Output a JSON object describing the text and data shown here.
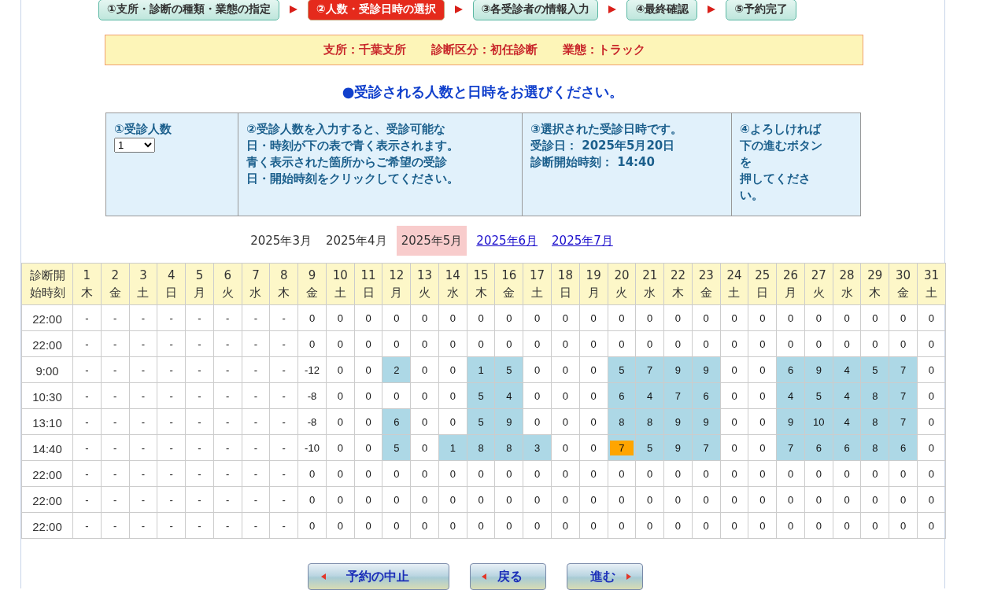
{
  "steps": [
    {
      "label": "①支所・診断の種類・業態の指定",
      "selected": false
    },
    {
      "label": "②人数・受診日時の選択",
      "selected": true
    },
    {
      "label": "③各受診者の情報入力",
      "selected": false
    },
    {
      "label": "④最終確認",
      "selected": false
    },
    {
      "label": "⑤予約完了",
      "selected": false
    }
  ],
  "info_bar": [
    "支所：千葉支所",
    "診断区分：初任診断",
    "業態：トラック"
  ],
  "heading": "●受診される人数と日時をお選びください。",
  "instructions": {
    "count": {
      "title": "①受診人数",
      "select_value": "1"
    },
    "guide": {
      "lines": [
        "②受診人数を入力すると、受診可能な",
        "日・時刻が下の表で青く表示されます。",
        "青く表示された箇所からご希望の受診",
        "日・開始時刻をクリックしてください。"
      ]
    },
    "selection": {
      "lines": [
        "③選択された受診日時です。",
        "受診日： 2025年5月20日",
        "診断開始時刻： 14:40"
      ]
    },
    "proceed": {
      "lines": [
        "④よろしければ",
        "下の進むボタン",
        "を",
        "押してくださ",
        "い。"
      ]
    }
  },
  "months": [
    {
      "label": "2025年3月",
      "link": false,
      "selected": false
    },
    {
      "label": "2025年4月",
      "link": false,
      "selected": false
    },
    {
      "label": "2025年5月",
      "link": false,
      "selected": true
    },
    {
      "label": "2025年6月",
      "link": true,
      "selected": false
    },
    {
      "label": "2025年7月",
      "link": true,
      "selected": false
    }
  ],
  "table": {
    "corner": [
      "診断開",
      "始時刻"
    ],
    "days": [
      [
        "1",
        "木"
      ],
      [
        "2",
        "金"
      ],
      [
        "3",
        "土"
      ],
      [
        "4",
        "日"
      ],
      [
        "5",
        "月"
      ],
      [
        "6",
        "火"
      ],
      [
        "7",
        "水"
      ],
      [
        "8",
        "木"
      ],
      [
        "9",
        "金"
      ],
      [
        "10",
        "土"
      ],
      [
        "11",
        "日"
      ],
      [
        "12",
        "月"
      ],
      [
        "13",
        "火"
      ],
      [
        "14",
        "水"
      ],
      [
        "15",
        "木"
      ],
      [
        "16",
        "金"
      ],
      [
        "17",
        "土"
      ],
      [
        "18",
        "日"
      ],
      [
        "19",
        "月"
      ],
      [
        "20",
        "火"
      ],
      [
        "21",
        "水"
      ],
      [
        "22",
        "木"
      ],
      [
        "23",
        "金"
      ],
      [
        "24",
        "土"
      ],
      [
        "25",
        "日"
      ],
      [
        "26",
        "月"
      ],
      [
        "27",
        "火"
      ],
      [
        "28",
        "水"
      ],
      [
        "29",
        "木"
      ],
      [
        "30",
        "金"
      ],
      [
        "31",
        "土"
      ]
    ],
    "rows": [
      {
        "time": "22:00",
        "cells": [
          {
            "text": "-",
            "available": false,
            "selected": false
          },
          {
            "text": "-",
            "available": false,
            "selected": false
          },
          {
            "text": "-",
            "available": false,
            "selected": false
          },
          {
            "text": "-",
            "available": false,
            "selected": false
          },
          {
            "text": "-",
            "available": false,
            "selected": false
          },
          {
            "text": "-",
            "available": false,
            "selected": false
          },
          {
            "text": "-",
            "available": false,
            "selected": false
          },
          {
            "text": "-",
            "available": false,
            "selected": false
          },
          {
            "text": "0",
            "available": false,
            "selected": false
          },
          {
            "text": "0",
            "available": false,
            "selected": false
          },
          {
            "text": "0",
            "available": false,
            "selected": false
          },
          {
            "text": "0",
            "available": false,
            "selected": false
          },
          {
            "text": "0",
            "available": false,
            "selected": false
          },
          {
            "text": "0",
            "available": false,
            "selected": false
          },
          {
            "text": "0",
            "available": false,
            "selected": false
          },
          {
            "text": "0",
            "available": false,
            "selected": false
          },
          {
            "text": "0",
            "available": false,
            "selected": false
          },
          {
            "text": "0",
            "available": false,
            "selected": false
          },
          {
            "text": "0",
            "available": false,
            "selected": false
          },
          {
            "text": "0",
            "available": false,
            "selected": false
          },
          {
            "text": "0",
            "available": false,
            "selected": false
          },
          {
            "text": "0",
            "available": false,
            "selected": false
          },
          {
            "text": "0",
            "available": false,
            "selected": false
          },
          {
            "text": "0",
            "available": false,
            "selected": false
          },
          {
            "text": "0",
            "available": false,
            "selected": false
          },
          {
            "text": "0",
            "available": false,
            "selected": false
          },
          {
            "text": "0",
            "available": false,
            "selected": false
          },
          {
            "text": "0",
            "available": false,
            "selected": false
          },
          {
            "text": "0",
            "available": false,
            "selected": false
          },
          {
            "text": "0",
            "available": false,
            "selected": false
          },
          {
            "text": "0",
            "available": false,
            "selected": false
          }
        ]
      },
      {
        "time": "22:00",
        "cells": [
          {
            "text": "-",
            "available": false,
            "selected": false
          },
          {
            "text": "-",
            "available": false,
            "selected": false
          },
          {
            "text": "-",
            "available": false,
            "selected": false
          },
          {
            "text": "-",
            "available": false,
            "selected": false
          },
          {
            "text": "-",
            "available": false,
            "selected": false
          },
          {
            "text": "-",
            "available": false,
            "selected": false
          },
          {
            "text": "-",
            "available": false,
            "selected": false
          },
          {
            "text": "-",
            "available": false,
            "selected": false
          },
          {
            "text": "0",
            "available": false,
            "selected": false
          },
          {
            "text": "0",
            "available": false,
            "selected": false
          },
          {
            "text": "0",
            "available": false,
            "selected": false
          },
          {
            "text": "0",
            "available": false,
            "selected": false
          },
          {
            "text": "0",
            "available": false,
            "selected": false
          },
          {
            "text": "0",
            "available": false,
            "selected": false
          },
          {
            "text": "0",
            "available": false,
            "selected": false
          },
          {
            "text": "0",
            "available": false,
            "selected": false
          },
          {
            "text": "0",
            "available": false,
            "selected": false
          },
          {
            "text": "0",
            "available": false,
            "selected": false
          },
          {
            "text": "0",
            "available": false,
            "selected": false
          },
          {
            "text": "0",
            "available": false,
            "selected": false
          },
          {
            "text": "0",
            "available": false,
            "selected": false
          },
          {
            "text": "0",
            "available": false,
            "selected": false
          },
          {
            "text": "0",
            "available": false,
            "selected": false
          },
          {
            "text": "0",
            "available": false,
            "selected": false
          },
          {
            "text": "0",
            "available": false,
            "selected": false
          },
          {
            "text": "0",
            "available": false,
            "selected": false
          },
          {
            "text": "0",
            "available": false,
            "selected": false
          },
          {
            "text": "0",
            "available": false,
            "selected": false
          },
          {
            "text": "0",
            "available": false,
            "selected": false
          },
          {
            "text": "0",
            "available": false,
            "selected": false
          },
          {
            "text": "0",
            "available": false,
            "selected": false
          }
        ]
      },
      {
        "time": "9:00",
        "cells": [
          {
            "text": "-",
            "available": false,
            "selected": false
          },
          {
            "text": "-",
            "available": false,
            "selected": false
          },
          {
            "text": "-",
            "available": false,
            "selected": false
          },
          {
            "text": "-",
            "available": false,
            "selected": false
          },
          {
            "text": "-",
            "available": false,
            "selected": false
          },
          {
            "text": "-",
            "available": false,
            "selected": false
          },
          {
            "text": "-",
            "available": false,
            "selected": false
          },
          {
            "text": "-",
            "available": false,
            "selected": false
          },
          {
            "text": "-12",
            "available": false,
            "selected": false
          },
          {
            "text": "0",
            "available": false,
            "selected": false
          },
          {
            "text": "0",
            "available": false,
            "selected": false
          },
          {
            "text": "2",
            "available": true,
            "selected": false
          },
          {
            "text": "0",
            "available": false,
            "selected": false
          },
          {
            "text": "0",
            "available": false,
            "selected": false
          },
          {
            "text": "1",
            "available": true,
            "selected": false
          },
          {
            "text": "5",
            "available": true,
            "selected": false
          },
          {
            "text": "0",
            "available": false,
            "selected": false
          },
          {
            "text": "0",
            "available": false,
            "selected": false
          },
          {
            "text": "0",
            "available": false,
            "selected": false
          },
          {
            "text": "5",
            "available": true,
            "selected": false
          },
          {
            "text": "7",
            "available": true,
            "selected": false
          },
          {
            "text": "9",
            "available": true,
            "selected": false
          },
          {
            "text": "9",
            "available": true,
            "selected": false
          },
          {
            "text": "0",
            "available": false,
            "selected": false
          },
          {
            "text": "0",
            "available": false,
            "selected": false
          },
          {
            "text": "6",
            "available": true,
            "selected": false
          },
          {
            "text": "9",
            "available": true,
            "selected": false
          },
          {
            "text": "4",
            "available": true,
            "selected": false
          },
          {
            "text": "5",
            "available": true,
            "selected": false
          },
          {
            "text": "7",
            "available": true,
            "selected": false
          },
          {
            "text": "0",
            "available": false,
            "selected": false
          }
        ]
      },
      {
        "time": "10:30",
        "cells": [
          {
            "text": "-",
            "available": false,
            "selected": false
          },
          {
            "text": "-",
            "available": false,
            "selected": false
          },
          {
            "text": "-",
            "available": false,
            "selected": false
          },
          {
            "text": "-",
            "available": false,
            "selected": false
          },
          {
            "text": "-",
            "available": false,
            "selected": false
          },
          {
            "text": "-",
            "available": false,
            "selected": false
          },
          {
            "text": "-",
            "available": false,
            "selected": false
          },
          {
            "text": "-",
            "available": false,
            "selected": false
          },
          {
            "text": "-8",
            "available": false,
            "selected": false
          },
          {
            "text": "0",
            "available": false,
            "selected": false
          },
          {
            "text": "0",
            "available": false,
            "selected": false
          },
          {
            "text": "0",
            "available": false,
            "selected": false
          },
          {
            "text": "0",
            "available": false,
            "selected": false
          },
          {
            "text": "0",
            "available": false,
            "selected": false
          },
          {
            "text": "5",
            "available": true,
            "selected": false
          },
          {
            "text": "4",
            "available": true,
            "selected": false
          },
          {
            "text": "0",
            "available": false,
            "selected": false
          },
          {
            "text": "0",
            "available": false,
            "selected": false
          },
          {
            "text": "0",
            "available": false,
            "selected": false
          },
          {
            "text": "6",
            "available": true,
            "selected": false
          },
          {
            "text": "4",
            "available": true,
            "selected": false
          },
          {
            "text": "7",
            "available": true,
            "selected": false
          },
          {
            "text": "6",
            "available": true,
            "selected": false
          },
          {
            "text": "0",
            "available": false,
            "selected": false
          },
          {
            "text": "0",
            "available": false,
            "selected": false
          },
          {
            "text": "4",
            "available": true,
            "selected": false
          },
          {
            "text": "5",
            "available": true,
            "selected": false
          },
          {
            "text": "4",
            "available": true,
            "selected": false
          },
          {
            "text": "8",
            "available": true,
            "selected": false
          },
          {
            "text": "7",
            "available": true,
            "selected": false
          },
          {
            "text": "0",
            "available": false,
            "selected": false
          }
        ]
      },
      {
        "time": "13:10",
        "cells": [
          {
            "text": "-",
            "available": false,
            "selected": false
          },
          {
            "text": "-",
            "available": false,
            "selected": false
          },
          {
            "text": "-",
            "available": false,
            "selected": false
          },
          {
            "text": "-",
            "available": false,
            "selected": false
          },
          {
            "text": "-",
            "available": false,
            "selected": false
          },
          {
            "text": "-",
            "available": false,
            "selected": false
          },
          {
            "text": "-",
            "available": false,
            "selected": false
          },
          {
            "text": "-",
            "available": false,
            "selected": false
          },
          {
            "text": "-8",
            "available": false,
            "selected": false
          },
          {
            "text": "0",
            "available": false,
            "selected": false
          },
          {
            "text": "0",
            "available": false,
            "selected": false
          },
          {
            "text": "6",
            "available": true,
            "selected": false
          },
          {
            "text": "0",
            "available": false,
            "selected": false
          },
          {
            "text": "0",
            "available": false,
            "selected": false
          },
          {
            "text": "5",
            "available": true,
            "selected": false
          },
          {
            "text": "9",
            "available": true,
            "selected": false
          },
          {
            "text": "0",
            "available": false,
            "selected": false
          },
          {
            "text": "0",
            "available": false,
            "selected": false
          },
          {
            "text": "0",
            "available": false,
            "selected": false
          },
          {
            "text": "8",
            "available": true,
            "selected": false
          },
          {
            "text": "8",
            "available": true,
            "selected": false
          },
          {
            "text": "9",
            "available": true,
            "selected": false
          },
          {
            "text": "9",
            "available": true,
            "selected": false
          },
          {
            "text": "0",
            "available": false,
            "selected": false
          },
          {
            "text": "0",
            "available": false,
            "selected": false
          },
          {
            "text": "9",
            "available": true,
            "selected": false
          },
          {
            "text": "10",
            "available": true,
            "selected": false
          },
          {
            "text": "4",
            "available": true,
            "selected": false
          },
          {
            "text": "8",
            "available": true,
            "selected": false
          },
          {
            "text": "7",
            "available": true,
            "selected": false
          },
          {
            "text": "0",
            "available": false,
            "selected": false
          }
        ]
      },
      {
        "time": "14:40",
        "cells": [
          {
            "text": "-",
            "available": false,
            "selected": false
          },
          {
            "text": "-",
            "available": false,
            "selected": false
          },
          {
            "text": "-",
            "available": false,
            "selected": false
          },
          {
            "text": "-",
            "available": false,
            "selected": false
          },
          {
            "text": "-",
            "available": false,
            "selected": false
          },
          {
            "text": "-",
            "available": false,
            "selected": false
          },
          {
            "text": "-",
            "available": false,
            "selected": false
          },
          {
            "text": "-",
            "available": false,
            "selected": false
          },
          {
            "text": "-10",
            "available": false,
            "selected": false
          },
          {
            "text": "0",
            "available": false,
            "selected": false
          },
          {
            "text": "0",
            "available": false,
            "selected": false
          },
          {
            "text": "5",
            "available": true,
            "selected": false
          },
          {
            "text": "0",
            "available": false,
            "selected": false
          },
          {
            "text": "1",
            "available": true,
            "selected": false
          },
          {
            "text": "8",
            "available": true,
            "selected": false
          },
          {
            "text": "8",
            "available": true,
            "selected": false
          },
          {
            "text": "3",
            "available": true,
            "selected": false
          },
          {
            "text": "0",
            "available": false,
            "selected": false
          },
          {
            "text": "0",
            "available": false,
            "selected": false
          },
          {
            "text": "7",
            "available": true,
            "selected": true
          },
          {
            "text": "5",
            "available": true,
            "selected": false
          },
          {
            "text": "9",
            "available": true,
            "selected": false
          },
          {
            "text": "7",
            "available": true,
            "selected": false
          },
          {
            "text": "0",
            "available": false,
            "selected": false
          },
          {
            "text": "0",
            "available": false,
            "selected": false
          },
          {
            "text": "7",
            "available": true,
            "selected": false
          },
          {
            "text": "6",
            "available": true,
            "selected": false
          },
          {
            "text": "6",
            "available": true,
            "selected": false
          },
          {
            "text": "8",
            "available": true,
            "selected": false
          },
          {
            "text": "6",
            "available": true,
            "selected": false
          },
          {
            "text": "0",
            "available": false,
            "selected": false
          }
        ]
      },
      {
        "time": "22:00",
        "cells": [
          {
            "text": "-",
            "available": false,
            "selected": false
          },
          {
            "text": "-",
            "available": false,
            "selected": false
          },
          {
            "text": "-",
            "available": false,
            "selected": false
          },
          {
            "text": "-",
            "available": false,
            "selected": false
          },
          {
            "text": "-",
            "available": false,
            "selected": false
          },
          {
            "text": "-",
            "available": false,
            "selected": false
          },
          {
            "text": "-",
            "available": false,
            "selected": false
          },
          {
            "text": "-",
            "available": false,
            "selected": false
          },
          {
            "text": "0",
            "available": false,
            "selected": false
          },
          {
            "text": "0",
            "available": false,
            "selected": false
          },
          {
            "text": "0",
            "available": false,
            "selected": false
          },
          {
            "text": "0",
            "available": false,
            "selected": false
          },
          {
            "text": "0",
            "available": false,
            "selected": false
          },
          {
            "text": "0",
            "available": false,
            "selected": false
          },
          {
            "text": "0",
            "available": false,
            "selected": false
          },
          {
            "text": "0",
            "available": false,
            "selected": false
          },
          {
            "text": "0",
            "available": false,
            "selected": false
          },
          {
            "text": "0",
            "available": false,
            "selected": false
          },
          {
            "text": "0",
            "available": false,
            "selected": false
          },
          {
            "text": "0",
            "available": false,
            "selected": false
          },
          {
            "text": "0",
            "available": false,
            "selected": false
          },
          {
            "text": "0",
            "available": false,
            "selected": false
          },
          {
            "text": "0",
            "available": false,
            "selected": false
          },
          {
            "text": "0",
            "available": false,
            "selected": false
          },
          {
            "text": "0",
            "available": false,
            "selected": false
          },
          {
            "text": "0",
            "available": false,
            "selected": false
          },
          {
            "text": "0",
            "available": false,
            "selected": false
          },
          {
            "text": "0",
            "available": false,
            "selected": false
          },
          {
            "text": "0",
            "available": false,
            "selected": false
          },
          {
            "text": "0",
            "available": false,
            "selected": false
          },
          {
            "text": "0",
            "available": false,
            "selected": false
          }
        ]
      },
      {
        "time": "22:00",
        "cells": [
          {
            "text": "-",
            "available": false,
            "selected": false
          },
          {
            "text": "-",
            "available": false,
            "selected": false
          },
          {
            "text": "-",
            "available": false,
            "selected": false
          },
          {
            "text": "-",
            "available": false,
            "selected": false
          },
          {
            "text": "-",
            "available": false,
            "selected": false
          },
          {
            "text": "-",
            "available": false,
            "selected": false
          },
          {
            "text": "-",
            "available": false,
            "selected": false
          },
          {
            "text": "-",
            "available": false,
            "selected": false
          },
          {
            "text": "0",
            "available": false,
            "selected": false
          },
          {
            "text": "0",
            "available": false,
            "selected": false
          },
          {
            "text": "0",
            "available": false,
            "selected": false
          },
          {
            "text": "0",
            "available": false,
            "selected": false
          },
          {
            "text": "0",
            "available": false,
            "selected": false
          },
          {
            "text": "0",
            "available": false,
            "selected": false
          },
          {
            "text": "0",
            "available": false,
            "selected": false
          },
          {
            "text": "0",
            "available": false,
            "selected": false
          },
          {
            "text": "0",
            "available": false,
            "selected": false
          },
          {
            "text": "0",
            "available": false,
            "selected": false
          },
          {
            "text": "0",
            "available": false,
            "selected": false
          },
          {
            "text": "0",
            "available": false,
            "selected": false
          },
          {
            "text": "0",
            "available": false,
            "selected": false
          },
          {
            "text": "0",
            "available": false,
            "selected": false
          },
          {
            "text": "0",
            "available": false,
            "selected": false
          },
          {
            "text": "0",
            "available": false,
            "selected": false
          },
          {
            "text": "0",
            "available": false,
            "selected": false
          },
          {
            "text": "0",
            "available": false,
            "selected": false
          },
          {
            "text": "0",
            "available": false,
            "selected": false
          },
          {
            "text": "0",
            "available": false,
            "selected": false
          },
          {
            "text": "0",
            "available": false,
            "selected": false
          },
          {
            "text": "0",
            "available": false,
            "selected": false
          },
          {
            "text": "0",
            "available": false,
            "selected": false
          }
        ]
      },
      {
        "time": "22:00",
        "cells": [
          {
            "text": "-",
            "available": false,
            "selected": false
          },
          {
            "text": "-",
            "available": false,
            "selected": false
          },
          {
            "text": "-",
            "available": false,
            "selected": false
          },
          {
            "text": "-",
            "available": false,
            "selected": false
          },
          {
            "text": "-",
            "available": false,
            "selected": false
          },
          {
            "text": "-",
            "available": false,
            "selected": false
          },
          {
            "text": "-",
            "available": false,
            "selected": false
          },
          {
            "text": "-",
            "available": false,
            "selected": false
          },
          {
            "text": "0",
            "available": false,
            "selected": false
          },
          {
            "text": "0",
            "available": false,
            "selected": false
          },
          {
            "text": "0",
            "available": false,
            "selected": false
          },
          {
            "text": "0",
            "available": false,
            "selected": false
          },
          {
            "text": "0",
            "available": false,
            "selected": false
          },
          {
            "text": "0",
            "available": false,
            "selected": false
          },
          {
            "text": "0",
            "available": false,
            "selected": false
          },
          {
            "text": "0",
            "available": false,
            "selected": false
          },
          {
            "text": "0",
            "available": false,
            "selected": false
          },
          {
            "text": "0",
            "available": false,
            "selected": false
          },
          {
            "text": "0",
            "available": false,
            "selected": false
          },
          {
            "text": "0",
            "available": false,
            "selected": false
          },
          {
            "text": "0",
            "available": false,
            "selected": false
          },
          {
            "text": "0",
            "available": false,
            "selected": false
          },
          {
            "text": "0",
            "available": false,
            "selected": false
          },
          {
            "text": "0",
            "available": false,
            "selected": false
          },
          {
            "text": "0",
            "available": false,
            "selected": false
          },
          {
            "text": "0",
            "available": false,
            "selected": false
          },
          {
            "text": "0",
            "available": false,
            "selected": false
          },
          {
            "text": "0",
            "available": false,
            "selected": false
          },
          {
            "text": "0",
            "available": false,
            "selected": false
          },
          {
            "text": "0",
            "available": false,
            "selected": false
          },
          {
            "text": "0",
            "available": false,
            "selected": false
          }
        ]
      }
    ]
  },
  "buttons": [
    {
      "label": "予約の中止",
      "kind": "back"
    },
    {
      "label": "戻る",
      "kind": "back"
    },
    {
      "label": "進む",
      "kind": "forward"
    }
  ]
}
